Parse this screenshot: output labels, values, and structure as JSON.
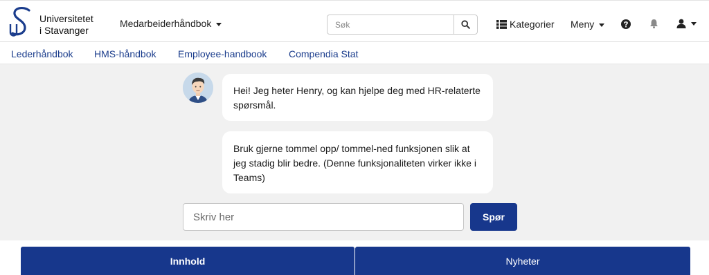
{
  "header": {
    "logo": {
      "line1": "Universitetet",
      "line2": "i Stavanger",
      "monogram": "US"
    },
    "handbook_dropdown": "Medarbeiderhåndbok",
    "search": {
      "placeholder": "Søk",
      "button_icon": "search-icon"
    },
    "categories_label": "Kategorier",
    "menu_label": "Meny",
    "icons": [
      "help-icon",
      "bell-icon",
      "user-icon"
    ]
  },
  "nav": {
    "links": [
      "Lederhåndbok",
      "HMS-håndbok",
      "Employee-handbook",
      "Compendia Stat"
    ]
  },
  "chat": {
    "messages": [
      "Hei! Jeg heter Henry, og kan hjelpe deg med HR-relaterte spørsmål.",
      "Bruk gjerne tommel opp/ tommel-ned funksjonen slik at jeg stadig blir bedre. (Denne funksjonaliteten virker ikke i Teams)"
    ],
    "input_placeholder": "Skriv her",
    "ask_button": "Spør"
  },
  "tabs": [
    "Innhold",
    "Nyheter"
  ],
  "colors": {
    "primary": "#17378c",
    "chat_bg": "#f1f1f1",
    "link": "#1a3c8c"
  }
}
